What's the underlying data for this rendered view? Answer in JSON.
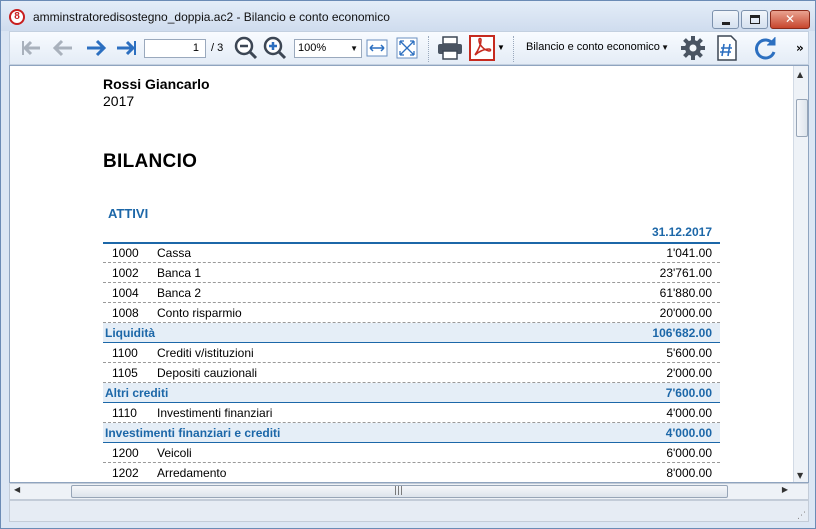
{
  "window": {
    "title": "amminstratoredisostegno_doppia.ac2 - Bilancio e conto economico",
    "app_icon_letter": "8"
  },
  "toolbar": {
    "page_current": "1",
    "page_total": "/ 3",
    "zoom": "100%",
    "report_name": "Bilancio e conto economico",
    "more": "»"
  },
  "report": {
    "company": "Rossi Giancarlo",
    "year": "2017",
    "title": "BILANCIO",
    "section": "ATTIVI",
    "date_column": "31.12.2017",
    "rows": [
      {
        "acct": "1000",
        "desc": "Cassa",
        "amount": "1'041.00",
        "total": false
      },
      {
        "acct": "1002",
        "desc": "Banca 1",
        "amount": "23'761.00",
        "total": false
      },
      {
        "acct": "1004",
        "desc": "Banca 2",
        "amount": "61'880.00",
        "total": false
      },
      {
        "acct": "1008",
        "desc": "Conto risparmio",
        "amount": "20'000.00",
        "total": false
      },
      {
        "acct": "",
        "desc": "Liquidità",
        "amount": "106'682.00",
        "total": true
      },
      {
        "acct": "1100",
        "desc": "Crediti v/istituzioni",
        "amount": "5'600.00",
        "total": false
      },
      {
        "acct": "1105",
        "desc": "Depositi cauzionali",
        "amount": "2'000.00",
        "total": false
      },
      {
        "acct": "",
        "desc": "Altri crediti",
        "amount": "7'600.00",
        "total": true
      },
      {
        "acct": "1110",
        "desc": "Investimenti finanziari",
        "amount": "4'000.00",
        "total": false
      },
      {
        "acct": "",
        "desc": "Investimenti finanziari e crediti",
        "amount": "4'000.00",
        "total": true
      },
      {
        "acct": "1200",
        "desc": "Veicoli",
        "amount": "6'000.00",
        "total": false
      },
      {
        "acct": "1202",
        "desc": "Arredamento",
        "amount": "8'000.00",
        "total": false
      }
    ]
  },
  "colors": {
    "accent": "#1c67a8",
    "total_row_bg": "#e5eef7",
    "nav_arrow": "#2c6fc0",
    "pdf_red": "#c62a1f"
  }
}
